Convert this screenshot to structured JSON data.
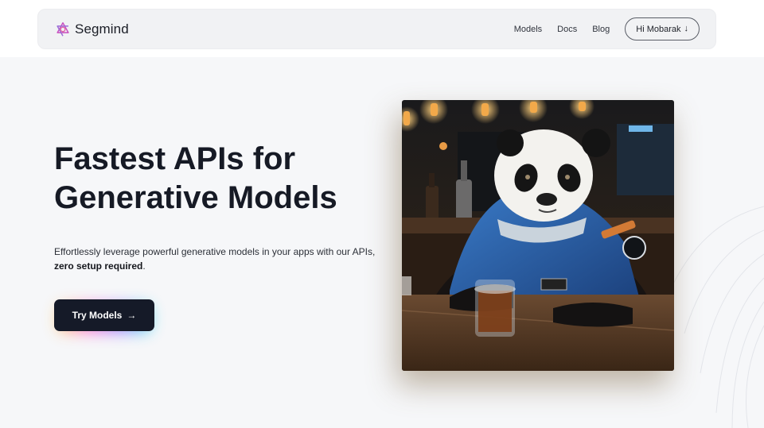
{
  "brand": {
    "name": "Segmind",
    "logo_icon": "segmind-knot-logo",
    "accent": "#c84fc0"
  },
  "nav": {
    "links": [
      "Models",
      "Docs",
      "Blog"
    ],
    "user_button": {
      "label": "Hi Mobarak",
      "icon": "arrow-down-icon"
    }
  },
  "hero": {
    "title_line1": "Fastest APIs for",
    "title_line2": "Generative Models",
    "subtitle_part1": "Effortlessly leverage powerful generative models in your apps with our APIs, ",
    "subtitle_bold": "zero setup required",
    "subtitle_end": ".",
    "cta_label": "Try Models",
    "cta_icon": "arrow-right-icon",
    "image_icon": "panda-astronaut-image"
  },
  "colors": {
    "page_bg": "#f6f7f9",
    "navbar_bg": "#f1f2f4",
    "cta_bg": "#151a28",
    "title_text": "#161a25"
  }
}
